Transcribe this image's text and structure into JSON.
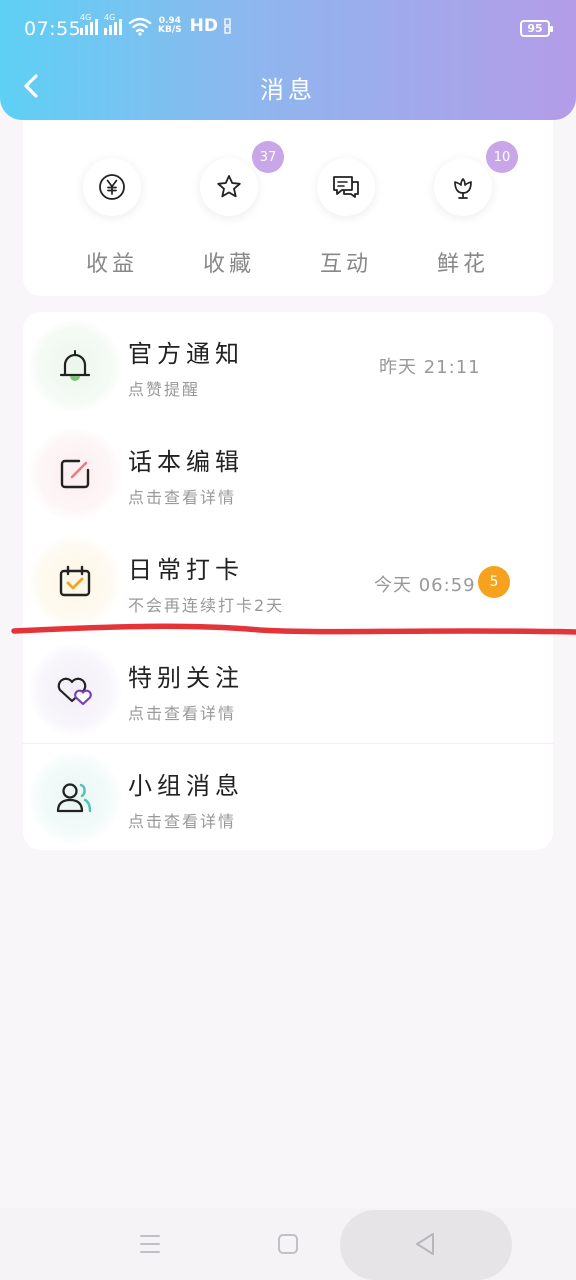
{
  "status_bar": {
    "time": "07:55",
    "net_speed_value": "0.94",
    "net_speed_unit": "KB/S",
    "hd": "HD",
    "sim1": "4G",
    "sim2": "4G",
    "battery": "95"
  },
  "header": {
    "title": "消息",
    "back_icon": "chevron-left-icon"
  },
  "quick_actions": [
    {
      "label": "收益",
      "icon": "yen-icon",
      "badge": ""
    },
    {
      "label": "收藏",
      "icon": "star-icon",
      "badge": "37"
    },
    {
      "label": "互动",
      "icon": "chat-icon",
      "badge": ""
    },
    {
      "label": "鲜花",
      "icon": "flower-icon",
      "badge": "10"
    }
  ],
  "messages": [
    {
      "title": "官方通知",
      "subtitle": "点赞提醒",
      "time": "昨天 21:11",
      "icon": "bell-icon"
    },
    {
      "title": "话本编辑",
      "subtitle": "点击查看详情",
      "time": "",
      "icon": "edit-icon"
    },
    {
      "title": "日常打卡",
      "subtitle": "不会再连续打卡2天",
      "time": "今天 06:59",
      "badge": "5",
      "icon": "calendar-check-icon"
    },
    {
      "title": "特别关注",
      "subtitle": "点击查看详情",
      "time": "",
      "icon": "hearts-icon"
    },
    {
      "title": "小组消息",
      "subtitle": "点击查看详情",
      "time": "",
      "icon": "group-icon"
    }
  ],
  "colors": {
    "header_gradient_start": "#5ed0f4",
    "header_gradient_end": "#b49ce8",
    "badge_purple": "#c8a6e8",
    "badge_orange": "#f6a21e",
    "annotation_red": "#e3343a"
  },
  "nav": {
    "menu_icon": "menu-icon",
    "home_icon": "home-square-icon",
    "back_icon": "back-triangle-icon"
  }
}
